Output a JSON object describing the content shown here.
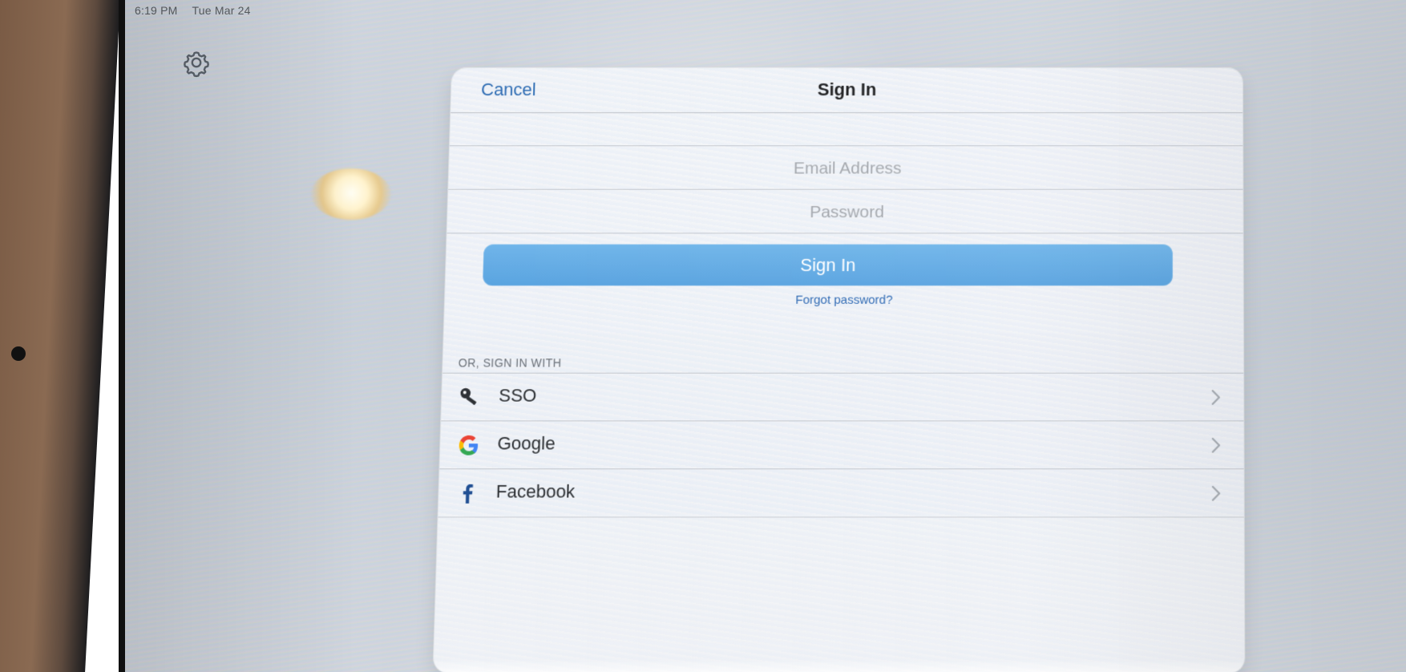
{
  "status_bar": {
    "time": "6:19 PM",
    "date": "Tue Mar 24"
  },
  "settings": {
    "icon": "gear-icon"
  },
  "sign_in_sheet": {
    "cancel_label": "Cancel",
    "title": "Sign In",
    "email_placeholder": "Email Address",
    "password_placeholder": "Password",
    "signin_button_label": "Sign In",
    "forgot_password_label": "Forgot password?",
    "section_heading": "OR, SIGN IN WITH",
    "providers": [
      {
        "label": "SSO",
        "icon": "key-icon"
      },
      {
        "label": "Google",
        "icon": "google-icon"
      },
      {
        "label": "Facebook",
        "icon": "facebook-icon"
      }
    ]
  },
  "colors": {
    "link_blue": "#2c6bb3",
    "button_blue": "#59a3e0",
    "text_dark": "#1c1d1f"
  }
}
